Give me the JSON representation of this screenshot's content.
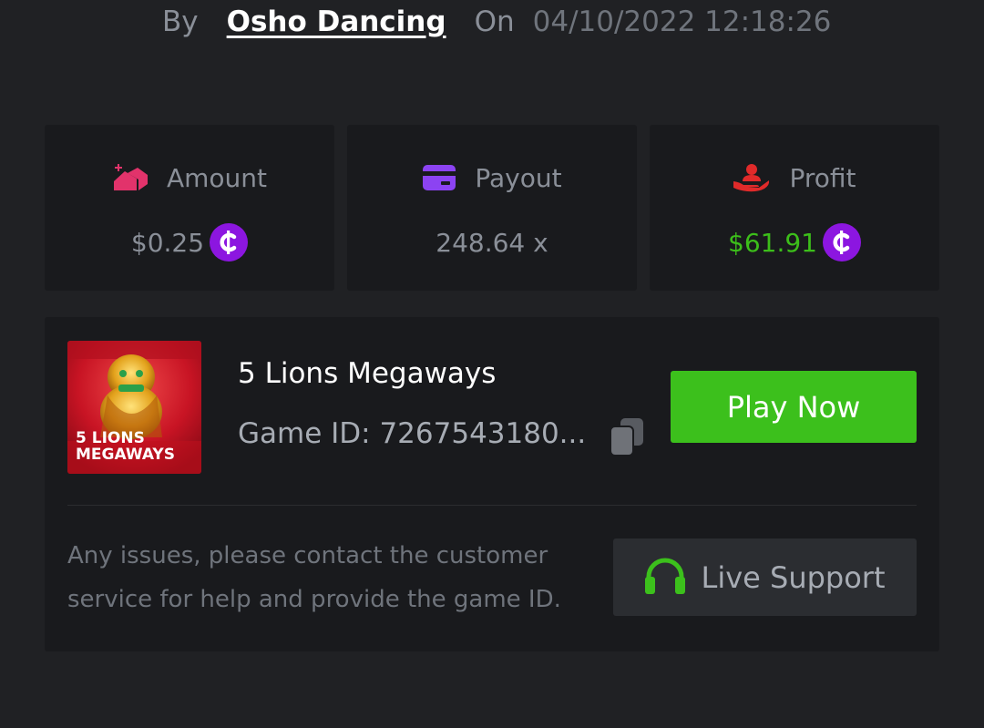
{
  "header": {
    "by_label": "By",
    "author": "Osho Dancing",
    "on_label": "On",
    "timestamp": "04/10/2022 12:18:26"
  },
  "stats": {
    "amount": {
      "label": "Amount",
      "value": "$0.25",
      "icon": "coin-stack-icon",
      "icon_color": "#e2336b"
    },
    "payout": {
      "label": "Payout",
      "value": "248.64 x",
      "icon": "card-icon",
      "icon_color": "#8c43f2"
    },
    "profit": {
      "label": "Profit",
      "value": "$61.91",
      "icon": "hand-user-icon",
      "icon_color": "#e02a2a",
      "value_color": "#3cbe1a"
    }
  },
  "currency_icon": {
    "name": "cedi-coin-icon",
    "color": "#8c16e0"
  },
  "game": {
    "title": "5 Lions Megaways",
    "game_id_text": "Game ID: 7267543180...",
    "thumbnail_line1": "5 LIONS",
    "thumbnail_line2": "MEGAWAYS",
    "play_label": "Play Now",
    "play_color": "#3cc01c"
  },
  "support": {
    "help_text": "Any issues, please contact the customer service for help and provide the game ID.",
    "button_label": "Live Support",
    "icon": "headphones-icon",
    "icon_color": "#3cc01c"
  }
}
